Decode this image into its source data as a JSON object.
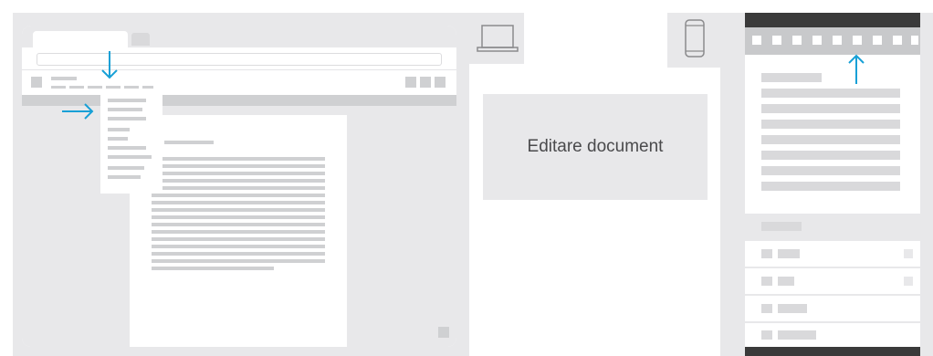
{
  "center_label": "Editare document",
  "colors": {
    "arrow": "#17a0d6",
    "panel": "#e8e8ea",
    "dark_bar": "#3a3a3a"
  },
  "icons": {
    "desktop": "laptop-icon",
    "mobile": "phone-icon"
  }
}
